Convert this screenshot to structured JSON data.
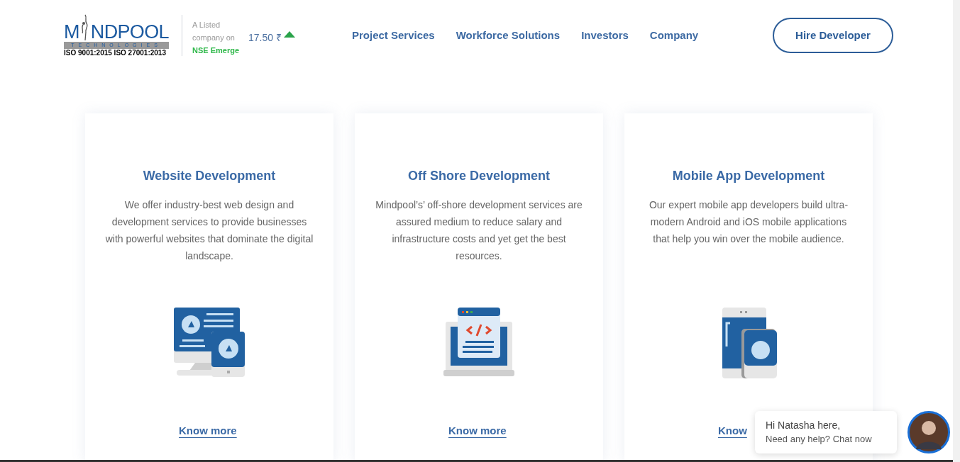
{
  "logo": {
    "wordmark_left": "M",
    "wordmark_right": "NDPOOL",
    "tagline": "TECHNOLOGIES",
    "certification": "ISO 9001:2015 ISO 27001:2013"
  },
  "listing": {
    "lines": [
      "A Listed",
      "company on"
    ],
    "exchange": "NSE Emerge"
  },
  "stock": {
    "price": "17.50 ₹"
  },
  "nav": [
    {
      "label": "Project Services"
    },
    {
      "label": "Workforce Solutions"
    },
    {
      "label": "Investors"
    },
    {
      "label": "Company"
    }
  ],
  "cta": {
    "label": "Hire Developer"
  },
  "cards": [
    {
      "kind": "web",
      "title": "Website Development",
      "description": "We offer industry-best web design and development services to provide businesses with powerful websites that dominate the digital landscape.",
      "link": "Know more"
    },
    {
      "kind": "offshore",
      "title": "Off Shore Development",
      "description": "Mindpool’s’ off-shore development services are assured medium to reduce salary and infrastructure costs and yet get the best resources.",
      "link": "Know more"
    },
    {
      "kind": "mobile",
      "title": "Mobile App Development",
      "description": "Our expert mobile app developers build ultra-modern Android and iOS mobile applications that help you win over the mobile audience.",
      "link": "Know"
    }
  ],
  "chat": {
    "greeting": "Hi Natasha here,",
    "prompt": "Need any help? Chat now"
  }
}
